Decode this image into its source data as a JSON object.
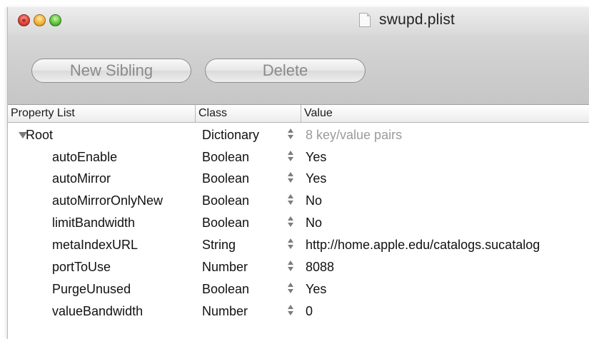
{
  "window": {
    "title": "swupd.plist"
  },
  "toolbar": {
    "new_sibling_label": "New Sibling",
    "delete_label": "Delete"
  },
  "table": {
    "columns": [
      "Property List",
      "Class",
      "Value"
    ],
    "root": {
      "name": "Root",
      "class": "Dictionary",
      "value": "8 key/value pairs",
      "expanded": true
    },
    "children": [
      {
        "name": "autoEnable",
        "class": "Boolean",
        "value": "Yes"
      },
      {
        "name": "autoMirror",
        "class": "Boolean",
        "value": "Yes"
      },
      {
        "name": "autoMirrorOnlyNew",
        "class": "Boolean",
        "value": "No"
      },
      {
        "name": "limitBandwidth",
        "class": "Boolean",
        "value": "No"
      },
      {
        "name": "metaIndexURL",
        "class": "String",
        "value": "http://home.apple.edu/catalogs.sucatalog"
      },
      {
        "name": "portToUse",
        "class": "Number",
        "value": "8088"
      },
      {
        "name": "PurgeUnused",
        "class": "Boolean",
        "value": "Yes"
      },
      {
        "name": "valueBandwidth",
        "class": "Number",
        "value": "0"
      }
    ]
  },
  "icons": {
    "close": "close-button-icon",
    "minimize": "minimize-button-icon",
    "zoom": "zoom-button-icon",
    "document": "document-icon",
    "disclosure": "disclosure-triangle-icon",
    "stepper": "up-down-stepper-icon"
  }
}
